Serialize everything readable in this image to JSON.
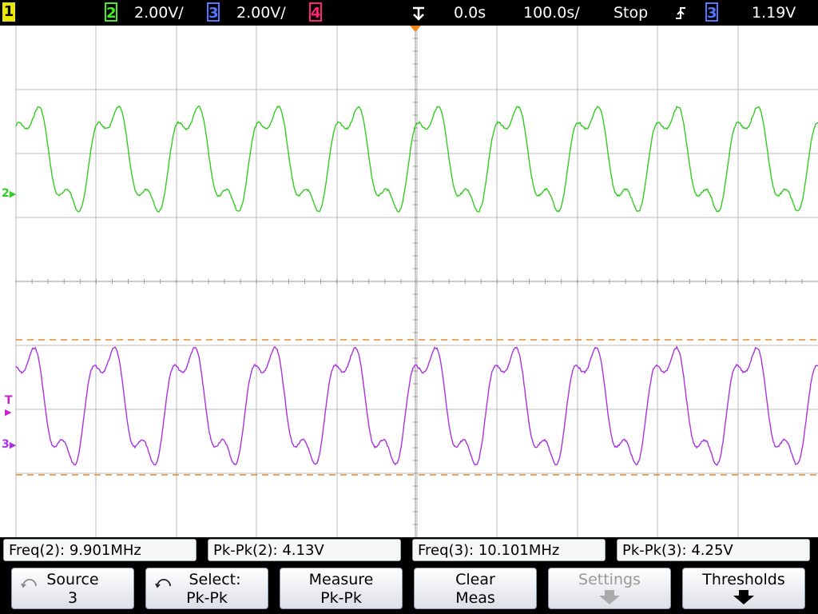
{
  "header": {
    "ch1": "1",
    "ch2": "2",
    "ch2_scale": "2.00V/",
    "ch3": "3",
    "ch3_scale": "2.00V/",
    "ch4": "4",
    "time_offset": "0.0s",
    "time_scale": "100.0s/",
    "run_state": "Stop",
    "trigger_slope_icon": "rising-edge-icon",
    "trigger_source": "3",
    "trigger_level": "1.19V"
  },
  "markers": {
    "ch2": "2",
    "trigger": "T",
    "ch3": "3"
  },
  "colors": {
    "ch1": "#e8e800",
    "ch2": "#44ee22",
    "ch3": "#5577ff",
    "ch4": "#ff2277",
    "trace_ch2": "#33cc22",
    "trace_ch3": "#aa33dd",
    "cursor": "#e08a2e",
    "trigger_marker": "#cc22cc",
    "grid": "#b8b8b8"
  },
  "measurements": [
    {
      "label": "Freq(2): 9.901MHz"
    },
    {
      "label": "Pk-Pk(2): 4.13V"
    },
    {
      "label": "Freq(3): 10.101MHz"
    },
    {
      "label": "Pk-Pk(3): 4.25V"
    }
  ],
  "softkeys": {
    "source": {
      "line1": "Source",
      "line2": "3"
    },
    "select": {
      "line1": "Select:",
      "line2": "Pk-Pk"
    },
    "measure": {
      "line1": "Measure",
      "line2": "Pk-Pk"
    },
    "clear": {
      "line1": "Clear",
      "line2": "Meas"
    },
    "settings": {
      "line1": "Settings"
    },
    "thresholds": {
      "line1": "Thresholds"
    }
  }
}
